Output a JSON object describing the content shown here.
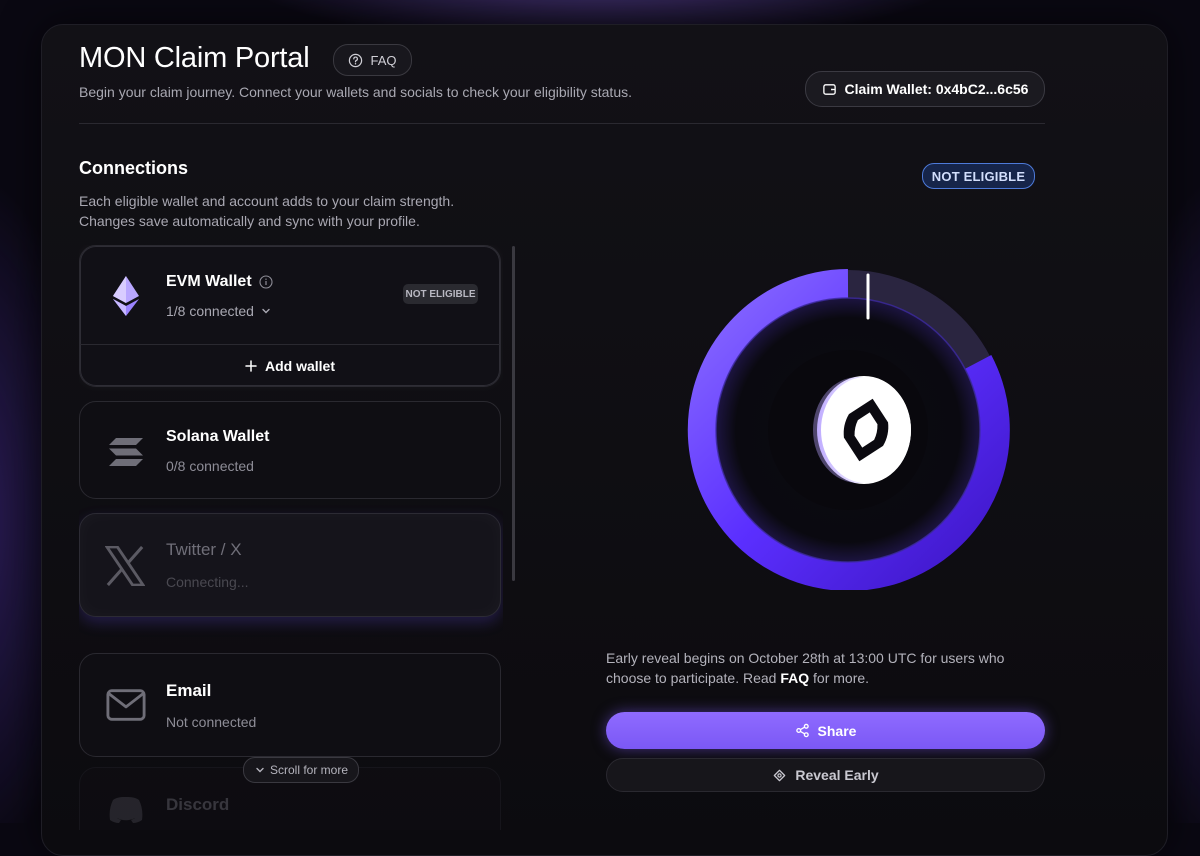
{
  "header": {
    "title": "MON Claim Portal",
    "faq_label": "FAQ",
    "subtitle": "Begin your claim journey. Connect your wallets and socials to check your eligibility status.",
    "claim_wallet_label": "Claim Wallet: 0x4bC2...6c56"
  },
  "connections": {
    "title": "Connections",
    "desc_line1": "Each eligible wallet and account adds to your claim strength.",
    "desc_line2": "Changes save automatically and sync with your profile.",
    "status_badge": "NOT ELIGIBLE",
    "items": [
      {
        "name": "EVM Wallet",
        "status": "1/8 connected",
        "badge": "NOT ELIGIBLE",
        "action": "Add wallet",
        "icon": "ethereum-icon"
      },
      {
        "name": "Solana Wallet",
        "status": "0/8 connected",
        "icon": "solana-icon"
      },
      {
        "name": "Twitter / X",
        "status": "Connecting...",
        "icon": "x-icon"
      },
      {
        "name": "Email",
        "status": "Not connected",
        "icon": "mail-icon"
      },
      {
        "name": "Discord",
        "icon": "discord-icon"
      }
    ],
    "scroll_hint": "Scroll for more"
  },
  "reveal": {
    "text_before": "Early reveal begins on October 28th at 13:00 UTC for users who choose to participate. Read ",
    "faq_link": "FAQ",
    "text_after": " for more.",
    "share_label": "Share",
    "reveal_early_label": "Reveal Early"
  },
  "colors": {
    "accent": "#7b58f5",
    "ring": "#5a2dff",
    "badge_blue": "#4d7ad9"
  }
}
